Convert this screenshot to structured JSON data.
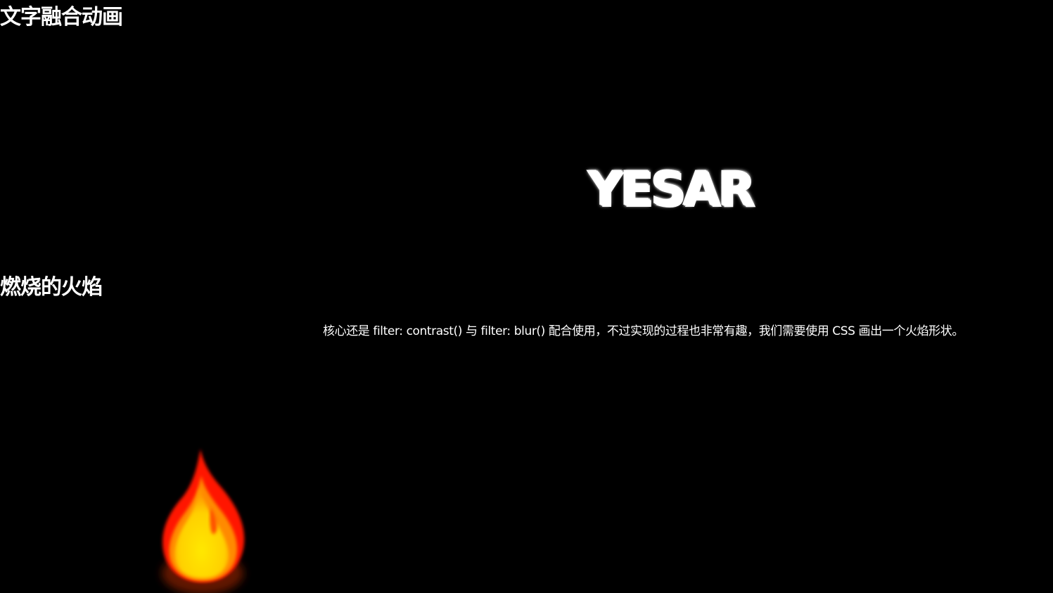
{
  "sections": {
    "fusion": {
      "title": "文字融合动画",
      "word": "YESAR"
    },
    "flame": {
      "title": "燃烧的火焰",
      "description": "核心还是 filter: contrast() 与 filter: blur() 配合使用，不过实现的过程也非常有趣，我们需要使用 CSS 画出一个火焰形状。"
    }
  },
  "colors": {
    "background": "#000000",
    "text": "#ffffff",
    "flame_outer": "#ff1a00",
    "flame_mid": "#ff8c00",
    "flame_core": "#ffee00"
  }
}
